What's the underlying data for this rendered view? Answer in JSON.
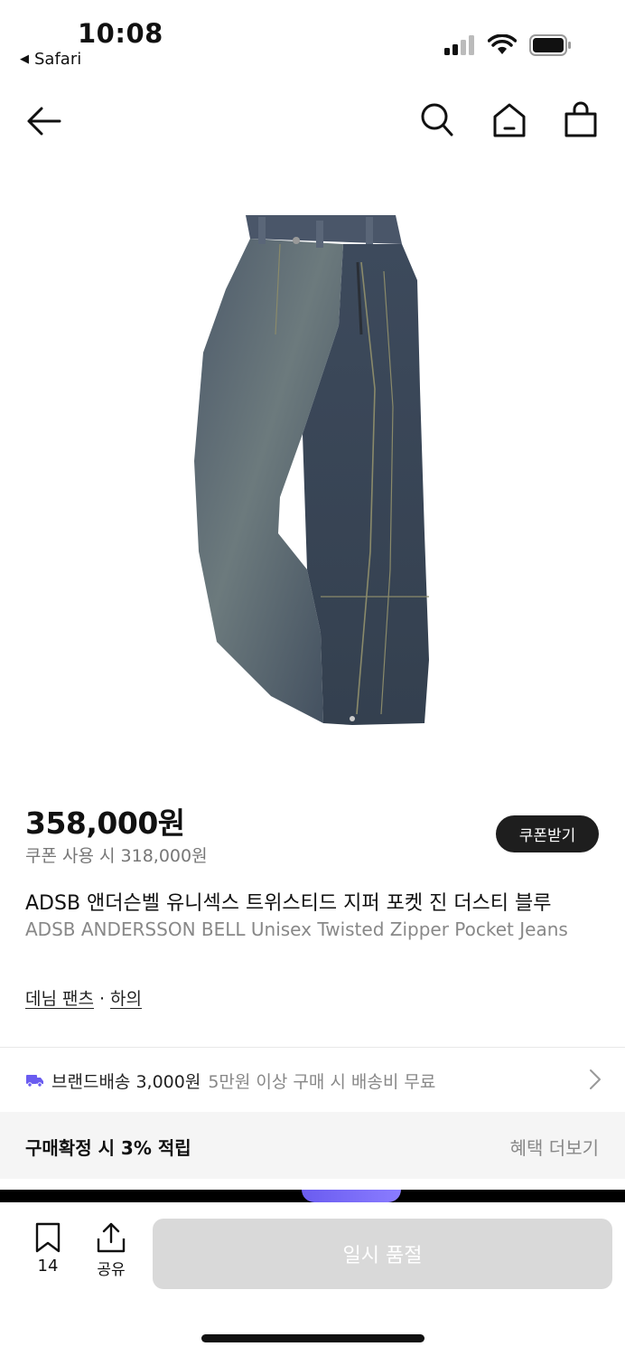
{
  "status_bar": {
    "time": "10:08",
    "back_app": "Safari",
    "icons": [
      "signal-icon",
      "wifi-icon",
      "battery-icon"
    ]
  },
  "nav": {
    "icons": [
      "back-arrow-icon",
      "search-icon",
      "home-icon",
      "shopping-bag-icon"
    ]
  },
  "product": {
    "image_description_icon": "denim-jeans-image",
    "price": "358,000원",
    "coupon_price": "쿠폰 사용 시 318,000원",
    "coupon_button": "쿠폰받기",
    "title_ko": "ADSB 앤더슨벨 유니섹스 트위스티드 지퍼 포켓 진 더스티 블루",
    "title_en": "ADSB ANDERSSON BELL Unisex Twisted Zipper Pocket Jeans",
    "category": {
      "primary": "데님 팬츠",
      "separator": "·",
      "secondary": "하의"
    }
  },
  "shipping": {
    "label": "브랜드배송 3,000원",
    "sub": "5만원 이상 구매 시 배송비 무료"
  },
  "reward": {
    "label": "구매확정 시 3% 적립",
    "more": "혜택 더보기"
  },
  "bottom_bar": {
    "bookmark_count": "14",
    "share_label": "공유",
    "soldout_label": "일시 품절"
  },
  "colors": {
    "accent_purple": "#6a5cf0",
    "coupon_bg": "#1e1e1e",
    "disabled_button": "#d9d9d9"
  }
}
